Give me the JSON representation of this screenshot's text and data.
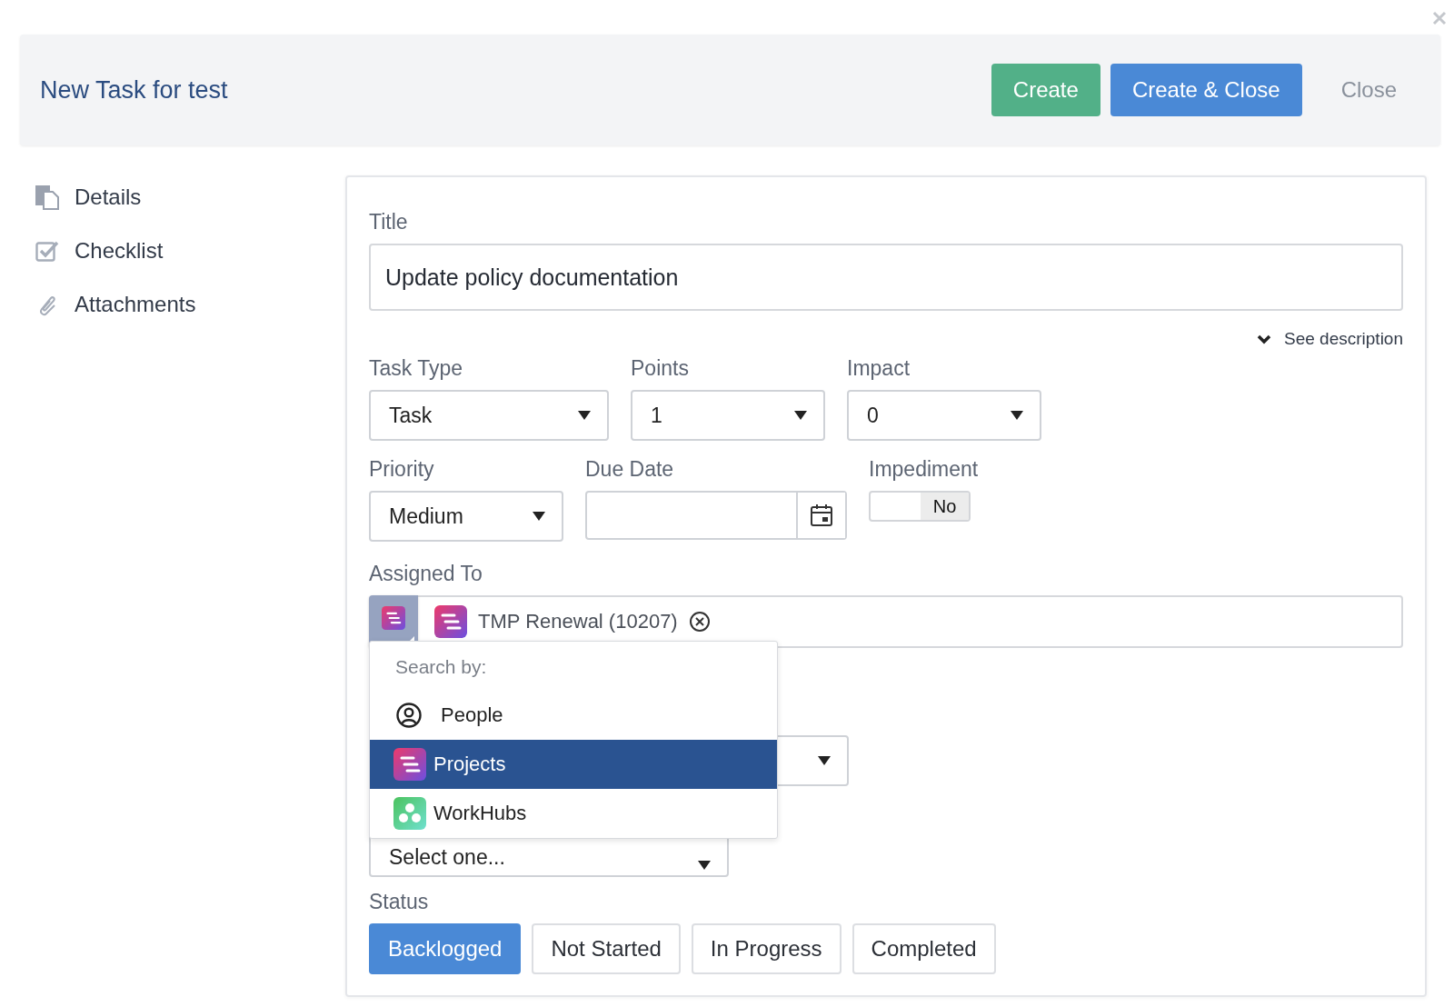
{
  "header": {
    "title": "New Task for test",
    "buttons": [
      {
        "label": "Create",
        "kind": "success"
      },
      {
        "label": "Create & Close",
        "kind": "primary"
      },
      {
        "label": "Close",
        "kind": "link"
      }
    ]
  },
  "sidebar": {
    "items": [
      {
        "label": "Details",
        "kind": "details"
      },
      {
        "label": "Checklist",
        "kind": "checklist"
      },
      {
        "label": "Attachments",
        "kind": "attachments"
      }
    ]
  },
  "form": {
    "title": {
      "label": "Title",
      "value": "Update policy documentation"
    },
    "description_toggle": "See description",
    "task_type": {
      "label": "Task Type",
      "value": "Task"
    },
    "points": {
      "label": "Points",
      "value": "1"
    },
    "impact": {
      "label": "Impact",
      "value": "0"
    },
    "priority": {
      "label": "Priority",
      "value": "Medium"
    },
    "due_date": {
      "label": "Due Date"
    },
    "impediment": {
      "label": "Impediment",
      "on": false,
      "text": "No"
    },
    "assigned_to": {
      "label": "Assigned To",
      "chips": [
        {
          "label": "TMP Renewal (10207)"
        }
      ]
    },
    "search_menu": {
      "heading": "Search by:",
      "options": [
        {
          "label": "People",
          "kind": "person",
          "selected": false
        },
        {
          "label": "Projects",
          "kind": "project",
          "selected": true
        },
        {
          "label": "WorkHubs",
          "kind": "workhub",
          "selected": false
        }
      ]
    },
    "select_placeholder": "Select one...",
    "status": {
      "label": "Status",
      "options": [
        {
          "label": "Backlogged",
          "selected": true
        },
        {
          "label": "Not Started",
          "selected": false
        },
        {
          "label": "In Progress",
          "selected": false
        },
        {
          "label": "Completed",
          "selected": false
        }
      ]
    }
  }
}
